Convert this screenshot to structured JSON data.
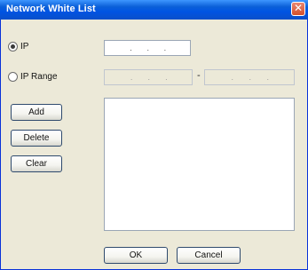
{
  "window": {
    "title": "Network White List",
    "close_symbol": "✕"
  },
  "options": {
    "ip_label": "IP",
    "ip_range_label": "IP Range",
    "selected": "ip"
  },
  "ip_dot": ".",
  "range_separator": "-",
  "buttons": {
    "add": "Add",
    "delete": "Delete",
    "clear": "Clear",
    "ok": "OK",
    "cancel": "Cancel"
  },
  "whitelist": {
    "items": []
  }
}
